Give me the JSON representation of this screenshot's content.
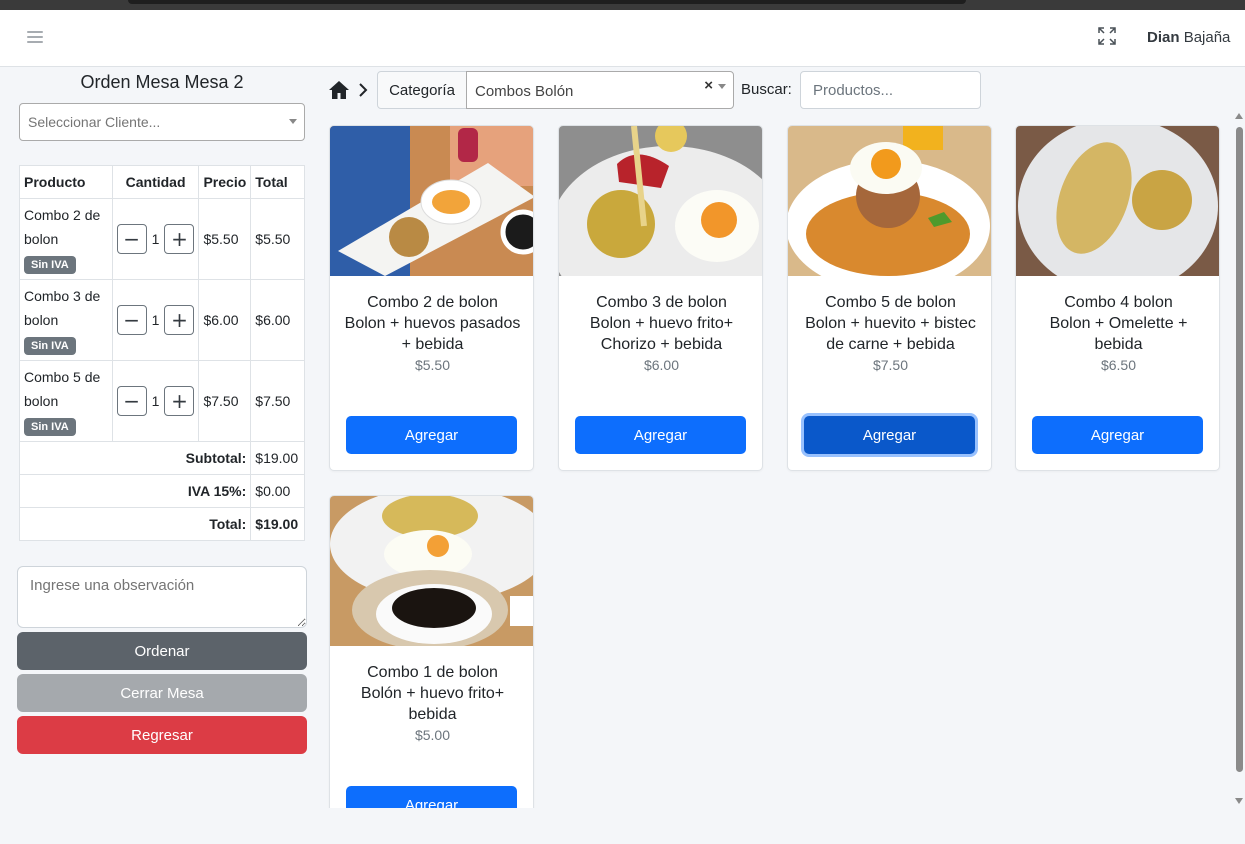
{
  "navbar": {
    "user_first": "Dian",
    "user_last": "Bajaña"
  },
  "order": {
    "title": "Orden Mesa Mesa 2",
    "client_placeholder": "Seleccionar Cliente...",
    "headers": [
      "Producto",
      "Cantidad",
      "Precio",
      "Total"
    ],
    "items": [
      {
        "name": "Combo 2 de bolon",
        "badge": "Sin IVA",
        "qty": "1",
        "price": "$5.50",
        "total": "$5.50"
      },
      {
        "name": "Combo 3 de bolon",
        "badge": "Sin IVA",
        "qty": "1",
        "price": "$6.00",
        "total": "$6.00"
      },
      {
        "name": "Combo 5 de bolon",
        "badge": "Sin IVA",
        "qty": "1",
        "price": "$7.50",
        "total": "$7.50"
      }
    ],
    "subtotal_label": "Subtotal:",
    "subtotal": "$19.00",
    "iva_label": "IVA 15%:",
    "iva": "$0.00",
    "total_label": "Total:",
    "total": "$19.00",
    "observation_placeholder": "Ingrese una observación",
    "btn_order": "Ordenar",
    "btn_close": "Cerrar Mesa",
    "btn_back": "Regresar"
  },
  "filters": {
    "category_label": "Categoría",
    "category_value": "Combos Bolón",
    "clear": "×",
    "search_label": "Buscar:",
    "search_placeholder": "Productos..."
  },
  "products": [
    {
      "name": "Combo 2 de bolon",
      "desc": "Bolon + huevos pasados + bebida",
      "price": "$5.50",
      "button": "Agregar"
    },
    {
      "name": "Combo 3 de bolon",
      "desc": "Bolon + huevo frito+ Chorizo + bebida",
      "price": "$6.00",
      "button": "Agregar"
    },
    {
      "name": "Combo 5 de bolon",
      "desc": "Bolon + huevito + bistec de carne + bebida",
      "price": "$7.50",
      "button": "Agregar"
    },
    {
      "name": "Combo 4 bolon",
      "desc": "Bolon + Omelette + bebida",
      "price": "$6.50",
      "button": "Agregar"
    },
    {
      "name": "Combo 1 de bolon",
      "desc": "Bolón + huevo frito+ bebida",
      "price": "$5.00",
      "button": "Agregar"
    }
  ],
  "colors": {
    "primary": "#0d6efd",
    "secondary": "#5c636a",
    "danger": "#dc3c45",
    "badge": "#6c757d"
  }
}
